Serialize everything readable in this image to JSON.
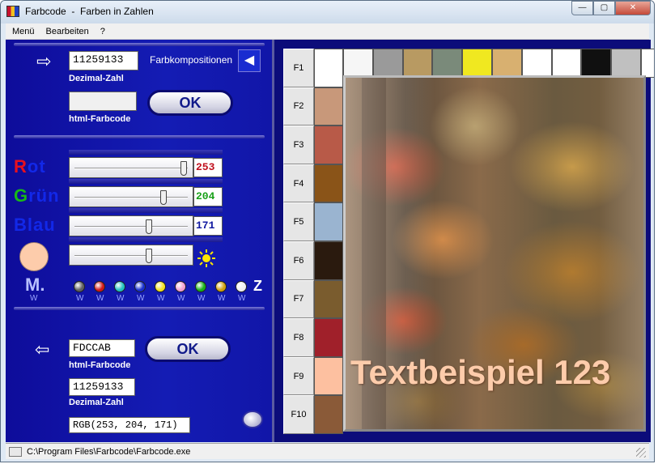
{
  "window": {
    "title": "Farbcode  -  Farben in Zahlen",
    "buttons": {
      "minimize": "—",
      "maximize": "▢",
      "close": "✕"
    }
  },
  "menu": [
    "Menü",
    "Bearbeiten",
    "?"
  ],
  "top_input": {
    "decimal_value": "11259133",
    "decimal_label": "Dezimal-Zahl",
    "html_value": "",
    "html_label": "html-Farbcode",
    "ok_label": "OK",
    "farbkompositionen_label": "Farbkompositionen"
  },
  "channels": {
    "red": {
      "label_first": "R",
      "label_rest": "ot",
      "value": "253",
      "color": "#e8101e",
      "fraction": 0.99
    },
    "green": {
      "label_first": "G",
      "label_rest": "rün",
      "value": "204",
      "color": "#18b818",
      "fraction": 0.8
    },
    "blue": {
      "label_first": "Blau",
      "label_rest": "",
      "value": "171",
      "color": "#1228e8",
      "fraction": 0.67
    },
    "brightness_fraction": 0.67
  },
  "current_color": "#fdccab",
  "memory": {
    "label": "M.",
    "w_label": "W",
    "z_label": "Z",
    "dots": [
      "#606060",
      "#d01818",
      "#20c0c0",
      "#1830d0",
      "#f0e020",
      "#f0a0d0",
      "#18b018",
      "#d0a010",
      "#f0f0f0"
    ]
  },
  "bottom_output": {
    "html_value": "FDCCAB",
    "html_label": "html-Farbcode",
    "ok_label": "OK",
    "decimal_value": "11259133",
    "decimal_label": "Dezimal-Zahl",
    "rgb_value": "RGB(253, 204, 171)"
  },
  "fkeys": [
    "F1",
    "F2",
    "F3",
    "F4",
    "F5",
    "F6",
    "F7",
    "F8",
    "F9",
    "F10"
  ],
  "fkey_colors": [
    "#ffffff",
    "#c8987a",
    "#b85a48",
    "#8a5418",
    "#9ab4d0",
    "#2a1a0e",
    "#7a5c2e",
    "#a0202a",
    "#fdc0a0",
    "#8a5a38"
  ],
  "composition_row": [
    "#f6f6f6",
    "#9a9a9a",
    "#b89a62",
    "#7a8a7a",
    "#f0e820",
    "#d8b070",
    "#ffffff",
    "#ffffff",
    "#101010",
    "#c0c0c0",
    "#ffffff"
  ],
  "preview_text": "Textbeispiel 123",
  "status_text": "C:\\Program Files\\Farbcode\\Farbcode.exe"
}
